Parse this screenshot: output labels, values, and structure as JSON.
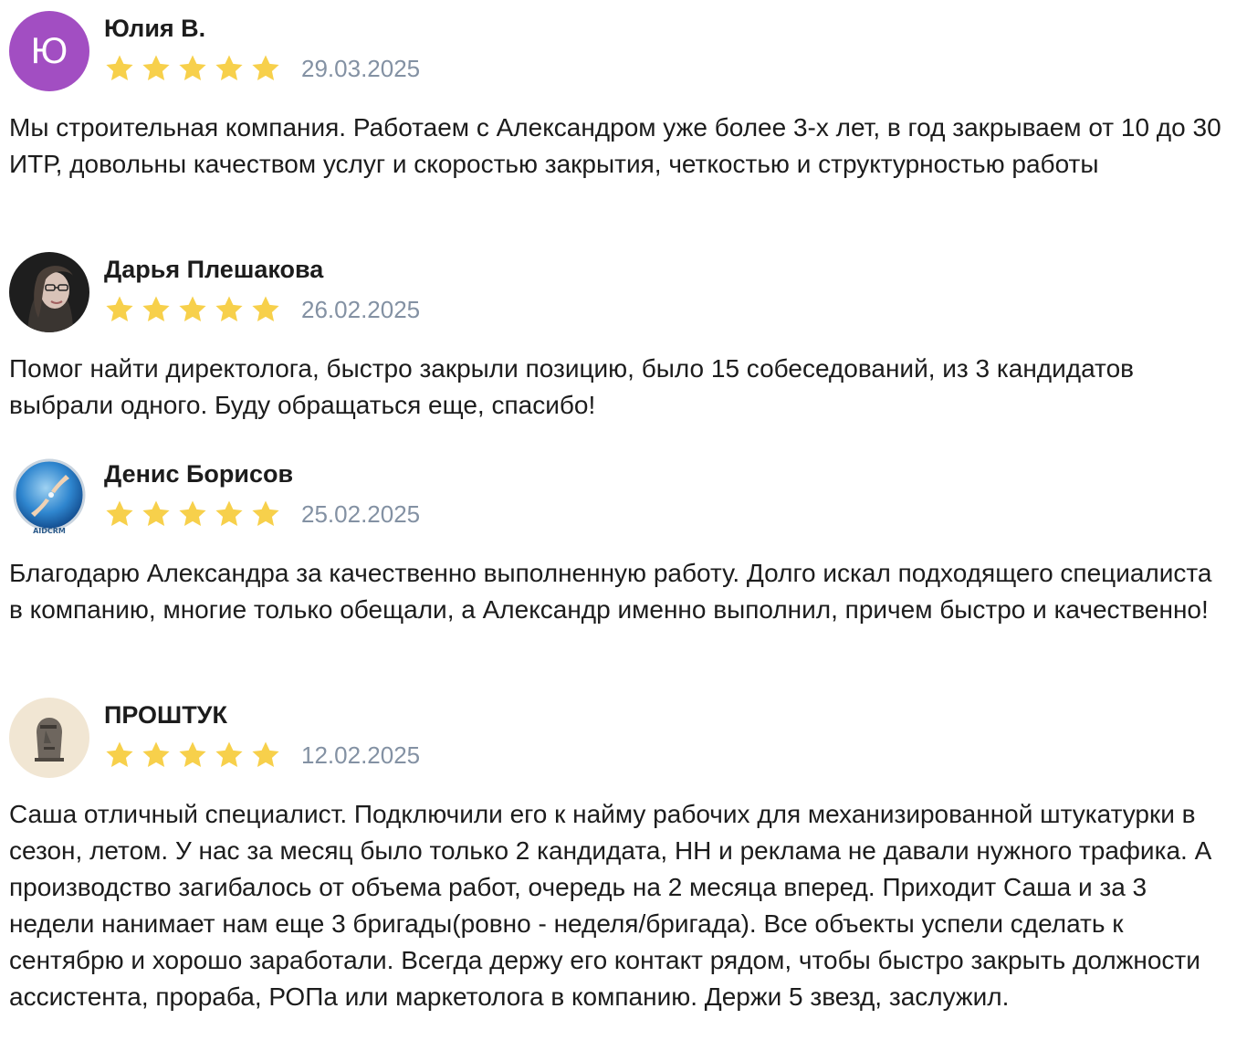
{
  "reviews": [
    {
      "avatar_letter": "Ю",
      "name": "Юлия В.",
      "rating": 5,
      "date": "29.03.2025",
      "text": "Мы строительная компания. Работаем с Александром уже более 3-х лет, в год закрываем от 10 до 30 ИТР, довольны качеством услуг и скоростью закрытия, четкостью и структурностью работы"
    },
    {
      "avatar_letter": "",
      "name": "Дарья Плешакова",
      "rating": 5,
      "date": "26.02.2025",
      "text": "Помог найти директолога, быстро закрыли позицию, было 15 собеседований, из 3 кандидатов выбрали одного. Буду обращаться еще, спасибо!"
    },
    {
      "avatar_letter": "",
      "avatar_logo_text": "AIDCRM",
      "name": "Денис Борисов",
      "rating": 5,
      "date": "25.02.2025",
      "text": "Благодарю Александра за качественно выполненную работу. Долго искал подходящего специалиста в компанию, многие только обещали, а Александр именно выполнил, причем быстро и качественно!"
    },
    {
      "avatar_letter": "",
      "name": "ПРОШТУК",
      "rating": 5,
      "date": "12.02.2025",
      "text": "Саша отличный специалист. Подключили его к найму рабочих для механизированной штукатурки в сезон, летом. У нас за месяц было только 2 кандидата, НН и реклама не давали нужного трафика. А производство загибалось от объема работ, очередь на 2 месяца вперед. Приходит Саша и за 3 недели нанимает нам еще 3 бригады(ровно - неделя/бригада). Все объекты успели сделать к сентябрю и хорошо заработали. Всегда держу его контакт рядом, чтобы быстро закрыть должности ассистента, прораба, РОПа или маркетолога в компанию. Держи 5 звезд, заслужил."
    }
  ],
  "colors": {
    "star": "#f7d04b",
    "date": "#8391a3",
    "avatar_letter_bg": "#a24ec2"
  },
  "icons": {
    "star": "star-icon"
  }
}
